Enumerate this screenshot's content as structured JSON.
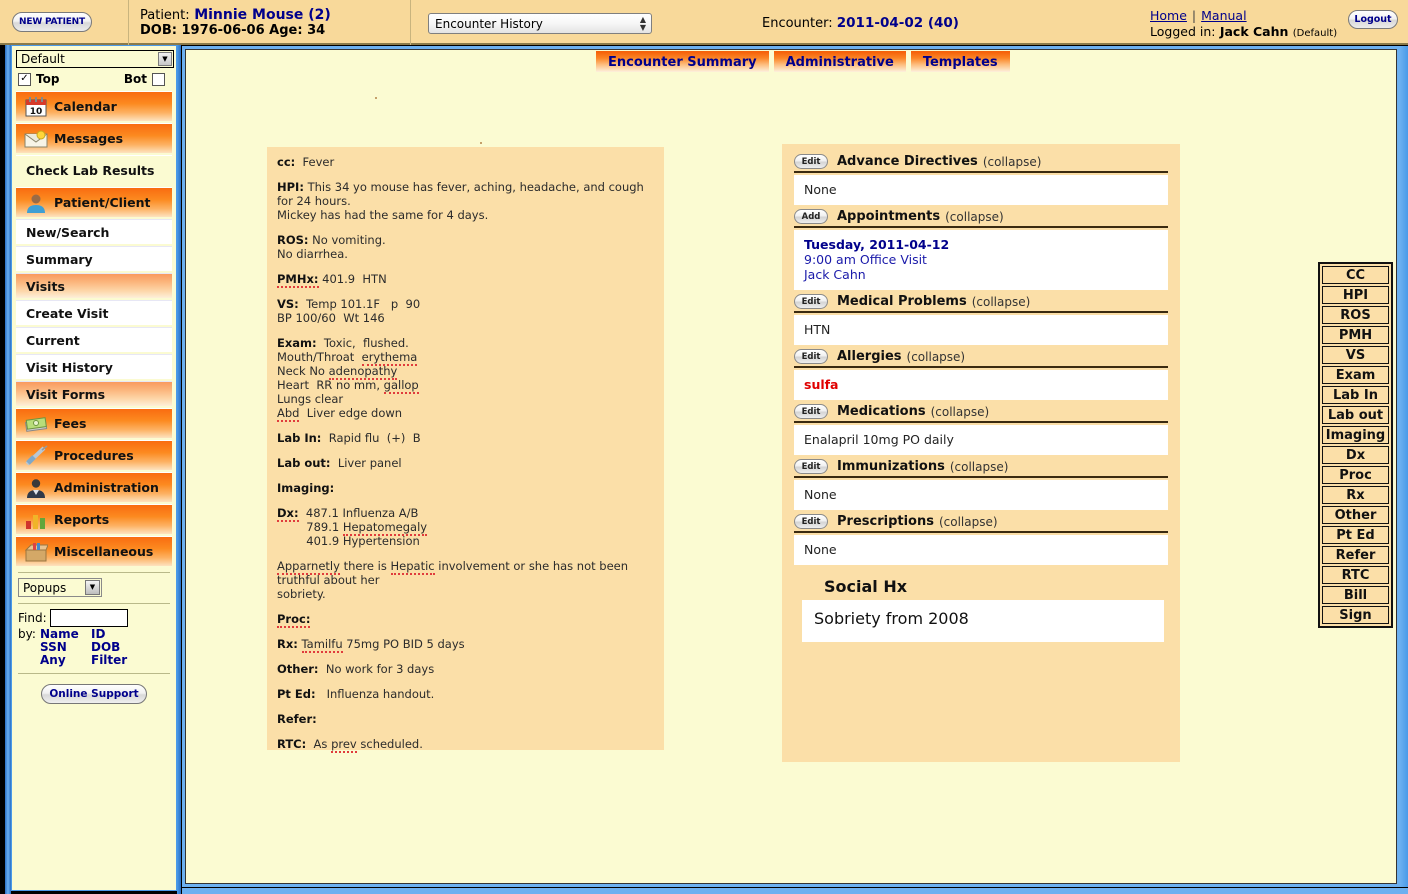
{
  "header": {
    "new_patient_label": "NEW PATIENT",
    "patient_label": "Patient:",
    "patient_name": "Minnie Mouse (2)",
    "dob_line": "DOB: 1976-06-06 Age: 34",
    "encounter_select_value": "Encounter History",
    "encounter_label": "Encounter:",
    "encounter_value": "2011-04-02 (40)",
    "home_link": "Home",
    "manual_link": "Manual",
    "separator": "|",
    "logged_in_label": "Logged in:",
    "logged_in_user": "Jack Cahn",
    "logged_in_default": "(Default)",
    "logout_label": "Logout"
  },
  "sidebar": {
    "theme_select_value": "Default",
    "top_label": "Top",
    "bot_label": "Bot",
    "top_checked": "✓",
    "items": [
      {
        "label": "Calendar",
        "type": "major",
        "icon": "calendar-icon"
      },
      {
        "label": "Messages",
        "type": "major",
        "icon": "envelope-icon"
      },
      {
        "label": "Check Lab Results",
        "type": "major-txt",
        "icon": ""
      },
      {
        "label": "Patient/Client",
        "type": "major",
        "icon": "person-icon"
      },
      {
        "label": "New/Search",
        "type": "sub",
        "icon": ""
      },
      {
        "label": "Summary",
        "type": "sub",
        "icon": ""
      },
      {
        "label": "Visits",
        "type": "sub-hl",
        "icon": ""
      },
      {
        "label": "Create Visit",
        "type": "sub",
        "icon": ""
      },
      {
        "label": "Current",
        "type": "sub",
        "icon": ""
      },
      {
        "label": "Visit History",
        "type": "sub",
        "icon": ""
      },
      {
        "label": "Visit Forms",
        "type": "sub-hl",
        "icon": ""
      },
      {
        "label": "Fees",
        "type": "major",
        "icon": "money-icon"
      },
      {
        "label": "Procedures",
        "type": "major",
        "icon": "syringe-icon"
      },
      {
        "label": "Administration",
        "type": "major",
        "icon": "admin-person-icon"
      },
      {
        "label": "Reports",
        "type": "major",
        "icon": "barchart-icon"
      },
      {
        "label": "Miscellaneous",
        "type": "major",
        "icon": "box-icon"
      }
    ],
    "popups_select_value": "Popups",
    "find_label": "Find:",
    "find_value": "",
    "by_label": "by:",
    "by_links": [
      "Name",
      "ID",
      "SSN",
      "DOB",
      "Any",
      "Filter"
    ],
    "online_support_label": "Online Support"
  },
  "tabs": [
    {
      "label": "Encounter Summary",
      "active": true
    },
    {
      "label": "Administrative",
      "active": false
    },
    {
      "label": "Templates",
      "active": false
    }
  ],
  "note": [
    {
      "key": "cc:",
      "text": "  Fever"
    },
    {
      "key": "HPI:",
      "text": " This 34 yo mouse has fever, aching, headache, and cough for 24 hours.\nMickey has had the same for 4 days."
    },
    {
      "key": "ROS:",
      "text": " No vomiting.\nNo diarrhea."
    },
    {
      "key": "PMHx:",
      "text": " 401.9  HTN",
      "key_misspelled": true
    },
    {
      "key": "VS:",
      "text": "  Temp 101.1F   p  90\nBP 100/60  Wt 146"
    },
    {
      "key": "Exam:",
      "text": "  Toxic,  flushed.\nMouth/Throat  erythema\nNeck No adenopathy\nHeart  RR no mm, gallop\nLungs clear\nAbd  Liver edge down"
    },
    {
      "key": "Lab In:",
      "text": "  Rapid flu  (+)  B"
    },
    {
      "key": "Lab out:",
      "text": "  Liver panel"
    },
    {
      "key": "Imaging:",
      "text": ""
    },
    {
      "key": "Dx:",
      "text": "  487.1 Influenza A/B\n        789.1 Hepatomegaly\n        401.9 Hypertension",
      "key_misspelled": true
    },
    {
      "key": "",
      "text": "Apparnetly there is Hepatic involvement or she has not been truthful about her\nsobriety."
    },
    {
      "key": "Proc:",
      "text": "",
      "key_misspelled": true
    },
    {
      "key": "Rx:",
      "text": " Tamilfu 75mg PO BID 5 days"
    },
    {
      "key": "Other:",
      "text": "  No work for 3 days"
    },
    {
      "key": "Pt Ed:",
      "text": "   Influenza handout."
    },
    {
      "key": "Refer:",
      "text": ""
    },
    {
      "key": "RTC:",
      "text": "  As prev scheduled."
    }
  ],
  "summary_sections": [
    {
      "button": "Edit",
      "title": "Advance Directives",
      "collapse": "(collapse)",
      "body": "None",
      "style": "plain"
    },
    {
      "button": "Add",
      "title": "Appointments",
      "collapse": "(collapse)",
      "appointment": {
        "date": "Tuesday, 2011-04-12",
        "time": "9:00 am Office Visit",
        "provider": "Jack Cahn"
      },
      "style": "appointment"
    },
    {
      "button": "Edit",
      "title": "Medical Problems",
      "collapse": "(collapse)",
      "body": "HTN",
      "style": "plain"
    },
    {
      "button": "Edit",
      "title": "Allergies",
      "collapse": "(collapse)",
      "body": "sulfa",
      "style": "allergy"
    },
    {
      "button": "Edit",
      "title": "Medications",
      "collapse": "(collapse)",
      "body": "Enalapril 10mg PO daily",
      "style": "plain"
    },
    {
      "button": "Edit",
      "title": "Immunizations",
      "collapse": "(collapse)",
      "body": "None",
      "style": "plain"
    },
    {
      "button": "Edit",
      "title": "Prescriptions",
      "collapse": "(collapse)",
      "body": "None",
      "style": "plain"
    }
  ],
  "social_hx": {
    "title": "Social Hx",
    "value": "Sobriety from 2008"
  },
  "nav_buttons": [
    "CC",
    "HPI",
    "ROS",
    "PMH",
    "VS",
    "Exam",
    "Lab  In",
    "Lab  out",
    "Imaging",
    "Dx",
    "Proc",
    "Rx",
    "Other",
    "Pt Ed",
    "Refer",
    "RTC",
    "Bill",
    "Sign"
  ],
  "colors": {
    "header_bg": "#f8d99a",
    "panel_bg": "#fbdfa8",
    "page_bg": "#fbfbd2",
    "accent_orange": "#f5610a",
    "link_blue": "#00008b",
    "allergy_red": "#e00000",
    "frame_blue": "#6cb0f0"
  }
}
